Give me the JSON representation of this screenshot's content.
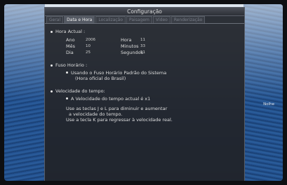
{
  "window": {
    "title": "Configuração",
    "tabs": [
      "Geral",
      "Data e Hora",
      "Localização",
      "Paisagem",
      "Vídeo",
      "Renderização"
    ],
    "active_tab": "Data e Hora"
  },
  "hora_actual": {
    "heading": "Hora Actual :",
    "rows": [
      {
        "label1": "Ano",
        "value1": "2006",
        "label2": "Hora",
        "value2": "11"
      },
      {
        "label1": "Mês",
        "value1": "10",
        "label2": "Minutos",
        "value2": "33"
      },
      {
        "label1": "Dia",
        "value1": "25",
        "label2": "Segundos",
        "value2": "51"
      }
    ]
  },
  "fuso_horario": {
    "heading": "Fuso Horário :",
    "option": "Usando o Fuso Horário Padrão do Sistema",
    "option_detail": "(Hora oficial do Brasil)"
  },
  "velocidade": {
    "heading": "Velocidade do tempo:",
    "status": "A Velocidade do tempo actual é x1",
    "help1": "Use as teclas J e L para diminuir e aumentar",
    "help2": "a velocidade do tempo.",
    "help3": "Use a tecla K para regressar à velocidade real."
  },
  "side_label": "Nolhe"
}
